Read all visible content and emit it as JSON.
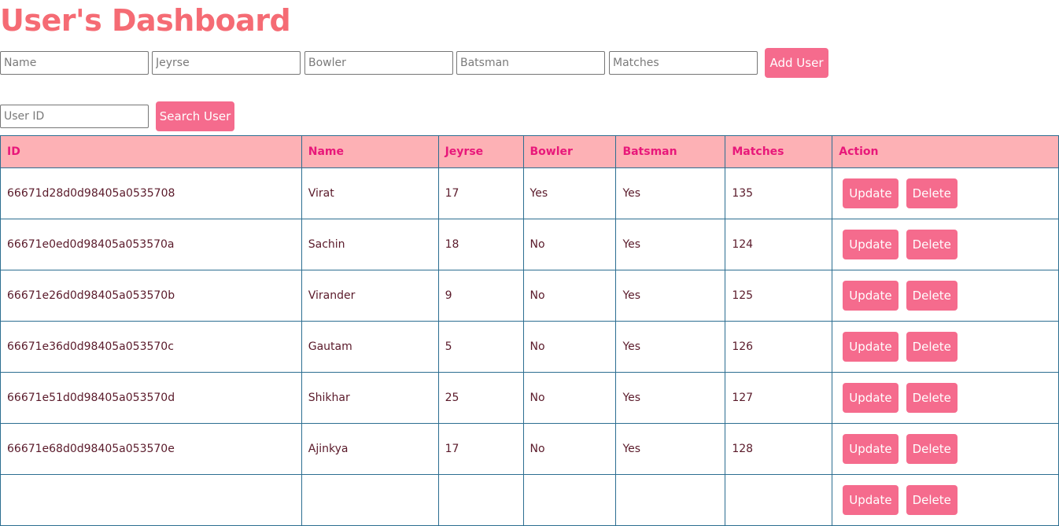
{
  "page": {
    "title": "User's Dashboard"
  },
  "add_form": {
    "name_placeholder": "Name",
    "jeyrse_placeholder": "Jeyrse",
    "bowler_placeholder": "Bowler",
    "batsman_placeholder": "Batsman",
    "matches_placeholder": "Matches",
    "add_button": "Add User"
  },
  "search_form": {
    "userid_placeholder": "User ID",
    "search_button": "Search User"
  },
  "table": {
    "headers": [
      "ID",
      "Name",
      "Jeyrse",
      "Bowler",
      "Batsman",
      "Matches",
      "Action"
    ],
    "update_label": "Update",
    "delete_label": "Delete",
    "rows": [
      {
        "id": "66671d28d0d98405a0535708",
        "name": "Virat",
        "jeyrse": "17",
        "bowler": "Yes",
        "batsman": "Yes",
        "matches": "135"
      },
      {
        "id": "66671e0ed0d98405a053570a",
        "name": "Sachin",
        "jeyrse": "18",
        "bowler": "No",
        "batsman": "Yes",
        "matches": "124"
      },
      {
        "id": "66671e26d0d98405a053570b",
        "name": "Virander",
        "jeyrse": "9",
        "bowler": "No",
        "batsman": "Yes",
        "matches": "125"
      },
      {
        "id": "66671e36d0d98405a053570c",
        "name": "Gautam",
        "jeyrse": "5",
        "bowler": "No",
        "batsman": "Yes",
        "matches": "126"
      },
      {
        "id": "66671e51d0d98405a053570d",
        "name": "Shikhar",
        "jeyrse": "25",
        "bowler": "No",
        "batsman": "Yes",
        "matches": "127"
      },
      {
        "id": "66671e68d0d98405a053570e",
        "name": "Ajinkya",
        "jeyrse": "17",
        "bowler": "No",
        "batsman": "Yes",
        "matches": "128"
      },
      {
        "id": "",
        "name": "",
        "jeyrse": "",
        "bowler": "",
        "batsman": "",
        "matches": ""
      }
    ]
  },
  "colors": {
    "title": "#f56b74",
    "button": "#f56b8d",
    "header_bg": "#fdb1b5",
    "header_text": "#e8187a",
    "border": "#2c6e91"
  }
}
